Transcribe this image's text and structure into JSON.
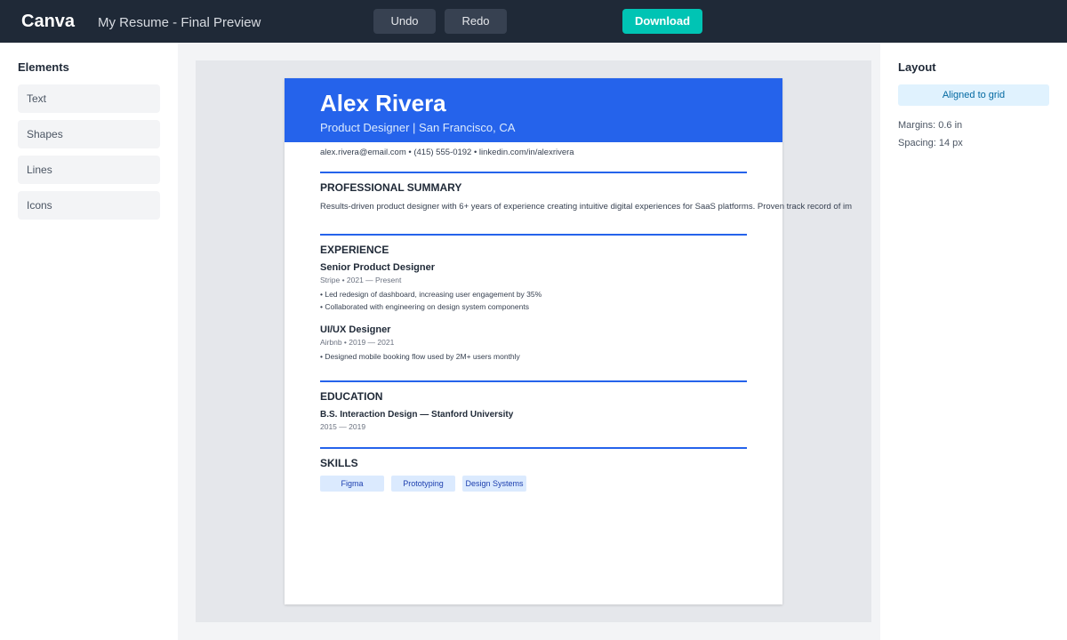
{
  "app": {
    "brand": "Canva",
    "document_title": "My Resume - Final Preview"
  },
  "toolbar": {
    "undo_label": "Undo",
    "redo_label": "Redo",
    "download_label": "Download"
  },
  "elements_panel": {
    "heading": "Elements",
    "items": [
      {
        "label": "Text"
      },
      {
        "label": "Shapes"
      },
      {
        "label": "Lines"
      },
      {
        "label": "Icons"
      }
    ]
  },
  "layout_panel": {
    "heading": "Layout",
    "grid_status": "Aligned to grid",
    "margins": "Margins: 0.6 in",
    "spacing": "Spacing: 14 px"
  },
  "resume": {
    "name": "Alex Rivera",
    "role": "Product Designer | San Francisco, CA",
    "contact": "alex.rivera@email.com • (415) 555-0192 • linkedin.com/in/alexrivera",
    "summary_heading": "PROFESSIONAL SUMMARY",
    "summary": "Results-driven product designer with 6+ years of experience creating intuitive digital experiences for SaaS platforms. Proven track record of im",
    "experience_heading": "EXPERIENCE",
    "jobs": [
      {
        "title": "Senior Product Designer",
        "meta": "Stripe • 2021 — Present",
        "bullets": [
          "• Led redesign of dashboard, increasing user engagement by 35%",
          "• Collaborated with engineering on design system components"
        ]
      },
      {
        "title": "UI/UX Designer",
        "meta": "Airbnb • 2019 — 2021",
        "bullets": [
          "• Designed mobile booking flow used by 2M+ users monthly"
        ]
      }
    ],
    "education_heading": "EDUCATION",
    "education": {
      "degree": "B.S. Interaction Design — Stanford University",
      "years": "2015 — 2019"
    },
    "skills_heading": "SKILLS",
    "skills": [
      "Figma",
      "Prototyping",
      "Design Systems"
    ]
  },
  "colors": {
    "topbar": "#1f2937",
    "accent": "#2563eb",
    "download": "#00c4b4"
  }
}
